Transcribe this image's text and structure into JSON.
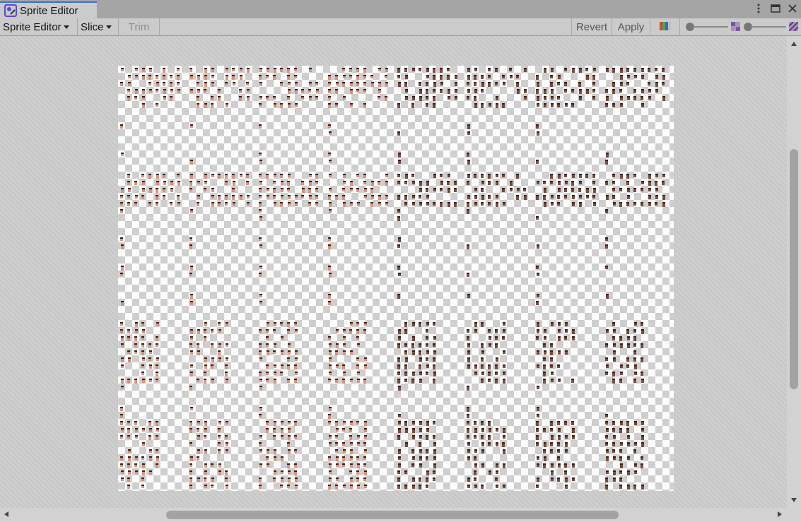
{
  "window": {
    "tab_title": "Sprite Editor",
    "icons": {
      "tab": "sprite-editor-icon",
      "more": "more-vertical-icon",
      "maximize": "maximize-icon",
      "close": "close-icon"
    }
  },
  "toolbar": {
    "mode_label": "Sprite Editor",
    "slice_label": "Slice",
    "trim_label": "Trim",
    "revert_label": "Revert",
    "apply_label": "Apply",
    "icons": {
      "color_channels": "rgb-channels-icon",
      "zoom_small": "mip-small-icon",
      "alpha": "alpha-checker-icon"
    }
  },
  "canvas": {
    "content": "sprite-sheet-grid",
    "colors": {
      "sprite_light": "#d98a72",
      "sprite_dark": "#6e3a2a",
      "outline": "#3a1d14"
    }
  }
}
